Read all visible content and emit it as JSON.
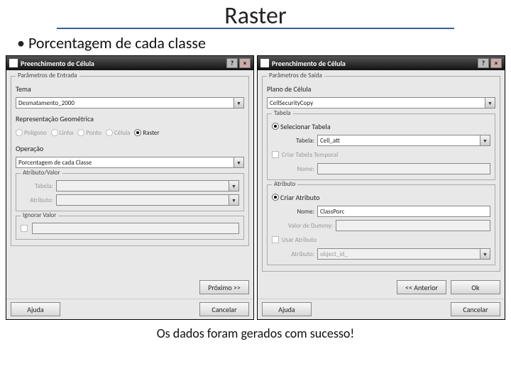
{
  "slide": {
    "title": "Raster",
    "bullet": "Porcentagem de cada classe",
    "footer": "Os dados foram gerados com sucesso!"
  },
  "left": {
    "title": "Preenchimento de Célula",
    "grp_input": "Parâmetros de Entrada",
    "lbl_tema": "Tema",
    "val_tema": "Desmatamento_2000",
    "lbl_repr": "Representação Geométrica",
    "rep_poligono": "Polígono",
    "rep_linha": "Linha",
    "rep_ponto": "Ponto",
    "rep_celula": "Célula",
    "rep_raster": "Raster",
    "lbl_op": "Operação",
    "val_op": "Porcentagem de cada Classe",
    "grp_attr": "Atributo/Valor",
    "lbl_tabela": "Tabela:",
    "lbl_atrib": "Atributo:",
    "grp_ignore": "Ignorar Valor",
    "btn_next": "Próximo >>",
    "btn_help": "Ajuda",
    "btn_cancel": "Cancelar"
  },
  "right": {
    "title": "Preenchimento de Célula",
    "grp_output": "Parâmetros de Saída",
    "lbl_plano": "Plano de Célula",
    "val_plano": "CellSecurityCopy",
    "grp_tabela": "Tabela",
    "rad_sel_tabela": "Selecionar Tabela",
    "lbl_tabela": "Tabela:",
    "val_tabela": "Cell_att",
    "chk_criar_temp": "Criar Tabela Temporal",
    "lbl_nome_tab": "Nome:",
    "grp_attr": "Atributo",
    "rad_criar_attr": "Criar Atributo",
    "lbl_nome_attr": "Nome:",
    "val_nome_attr": "ClassPorc",
    "lbl_dummy": "Valor de Dummy:",
    "chk_usar_attr": "Usar Atributo",
    "lbl_atrib": "Atributo:",
    "val_atrib": "object_id_",
    "btn_prev": "<< Anterior",
    "btn_ok": "Ok",
    "btn_help": "Ajuda",
    "btn_cancel": "Cancelar"
  }
}
